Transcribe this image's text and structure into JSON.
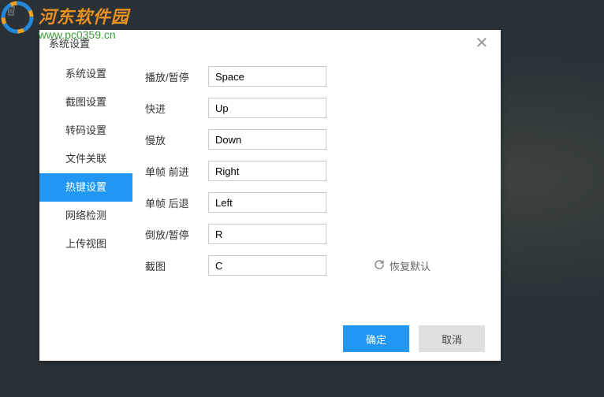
{
  "watermark": {
    "title": "河东软件园",
    "url": "www.pc0359.cn"
  },
  "dialog": {
    "title": "系统设置"
  },
  "sidebar": {
    "items": [
      {
        "label": "系统设置"
      },
      {
        "label": "截图设置"
      },
      {
        "label": "转码设置"
      },
      {
        "label": "文件关联"
      },
      {
        "label": "热键设置"
      },
      {
        "label": "网络检测"
      },
      {
        "label": "上传视图"
      }
    ]
  },
  "hotkeys": {
    "rows": [
      {
        "label": "播放/暂停",
        "value": "Space"
      },
      {
        "label": "快进",
        "value": "Up"
      },
      {
        "label": "慢放",
        "value": "Down"
      },
      {
        "label": "单帧 前进",
        "value": "Right"
      },
      {
        "label": "单帧 后退",
        "value": "Left"
      },
      {
        "label": "倒放/暂停",
        "value": "R"
      },
      {
        "label": "截图",
        "value": "C"
      }
    ],
    "restore_label": "恢复默认"
  },
  "footer": {
    "ok": "确定",
    "cancel": "取消"
  }
}
